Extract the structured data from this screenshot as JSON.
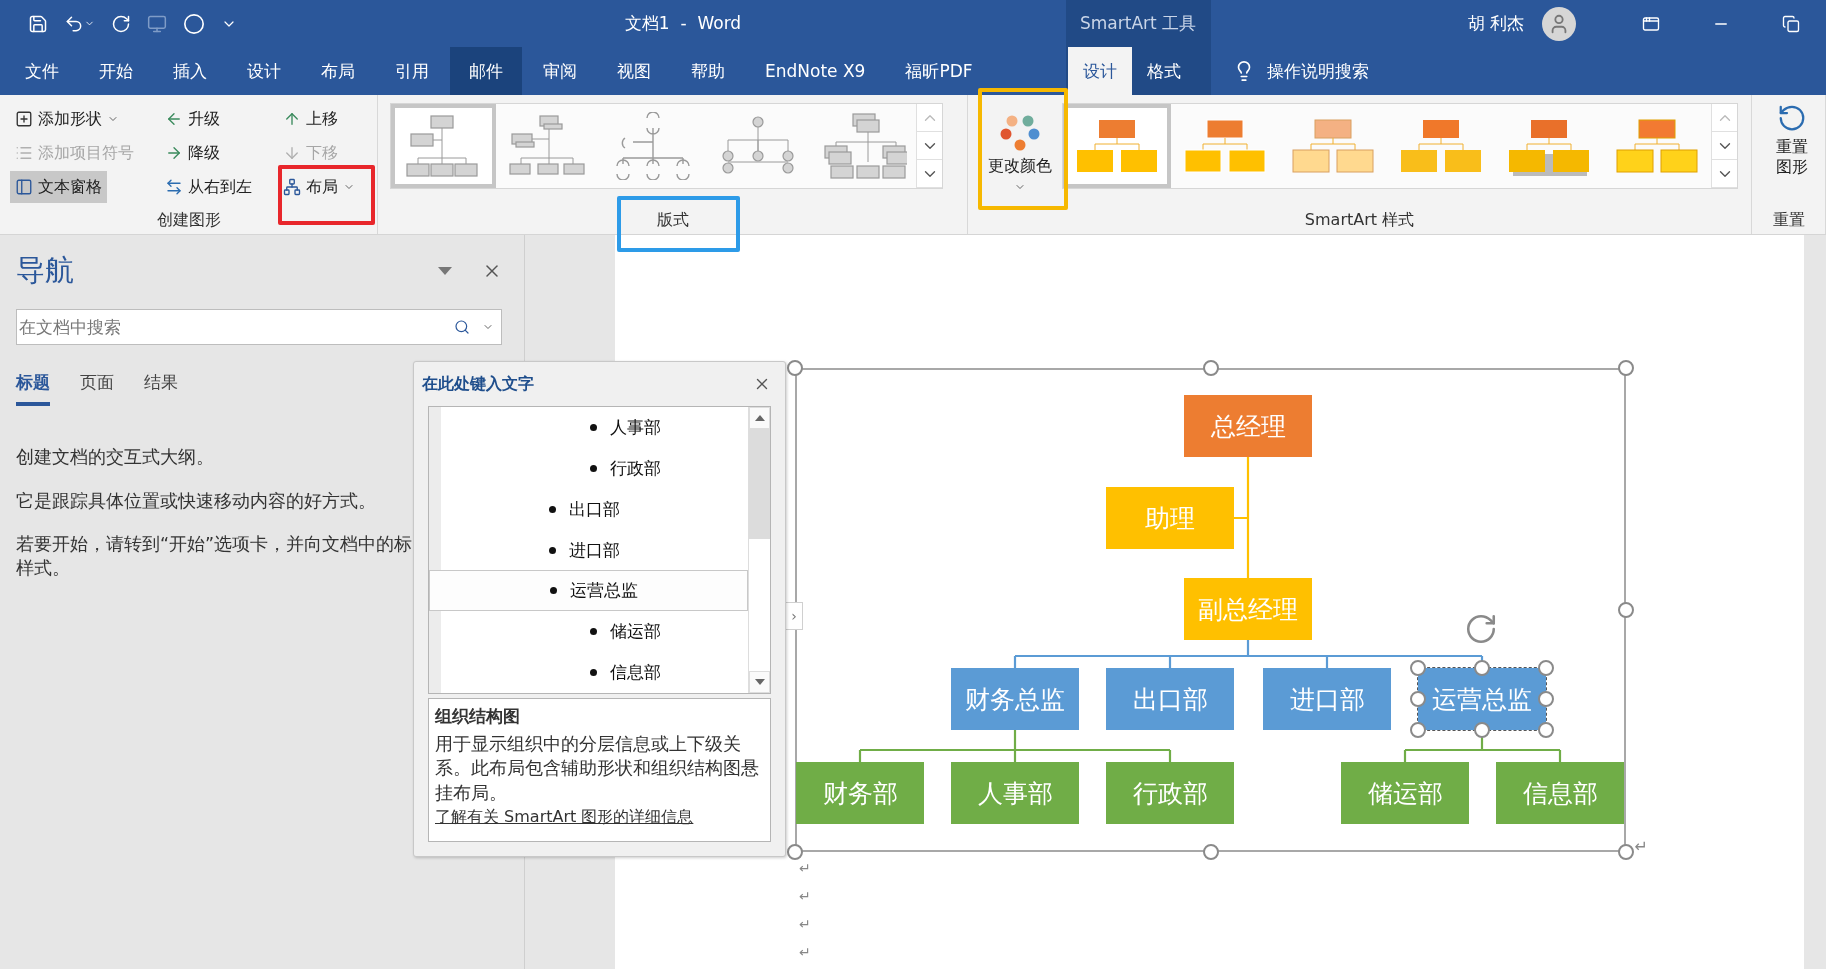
{
  "title_bar": {
    "title": "文档1  -  Word",
    "context_label": "SmartArt 工具",
    "user": "胡 利杰"
  },
  "ribbon_tabs": [
    {
      "label": "文件",
      "kind": "main",
      "selected": false,
      "hovered": false
    },
    {
      "label": "开始",
      "kind": "main",
      "selected": false,
      "hovered": false
    },
    {
      "label": "插入",
      "kind": "main",
      "selected": false,
      "hovered": false
    },
    {
      "label": "设计",
      "kind": "main",
      "selected": false,
      "hovered": false
    },
    {
      "label": "布局",
      "kind": "main",
      "selected": false,
      "hovered": false
    },
    {
      "label": "引用",
      "kind": "main",
      "selected": false,
      "hovered": false
    },
    {
      "label": "邮件",
      "kind": "main",
      "selected": false,
      "hovered": true
    },
    {
      "label": "审阅",
      "kind": "main",
      "selected": false,
      "hovered": false
    },
    {
      "label": "视图",
      "kind": "main",
      "selected": false,
      "hovered": false
    },
    {
      "label": "帮助",
      "kind": "main",
      "selected": false,
      "hovered": false
    },
    {
      "label": "EndNote X9",
      "kind": "main",
      "selected": false,
      "hovered": false
    },
    {
      "label": "福昕PDF",
      "kind": "main",
      "selected": false,
      "hovered": false
    },
    {
      "label": "设计",
      "kind": "contextual",
      "selected": true
    },
    {
      "label": "格式",
      "kind": "contextual",
      "selected": false
    }
  ],
  "tell_me": "操作说明搜索",
  "create_group": {
    "label": "创建图形",
    "commands": [
      {
        "label": "添加形状",
        "dropdown": true,
        "disabled": false,
        "pressed": false
      },
      {
        "label": "添加项目符号",
        "dropdown": false,
        "disabled": true,
        "pressed": false
      },
      {
        "label": "文本窗格",
        "dropdown": false,
        "disabled": false,
        "pressed": true
      },
      {
        "label": "升级",
        "dropdown": false,
        "disabled": false,
        "pressed": false
      },
      {
        "label": "降级",
        "dropdown": false,
        "disabled": false,
        "pressed": false
      },
      {
        "label": "从右到左",
        "dropdown": false,
        "disabled": false,
        "pressed": false
      },
      {
        "label": "上移",
        "dropdown": false,
        "disabled": false,
        "pressed": false
      },
      {
        "label": "下移",
        "dropdown": false,
        "disabled": true,
        "pressed": false
      },
      {
        "label": "布局",
        "dropdown": true,
        "disabled": false,
        "pressed": false
      }
    ]
  },
  "layouts_group": {
    "label": "版式",
    "items": [
      {
        "kind": "org",
        "selected": true
      },
      {
        "kind": "name-title",
        "selected": false
      },
      {
        "kind": "half-circle",
        "selected": false
      },
      {
        "kind": "circle",
        "selected": false
      },
      {
        "kind": "stacked",
        "selected": false
      }
    ]
  },
  "color_button": {
    "label": "更改颜色"
  },
  "styles_group": {
    "label": "SmartArt 样式",
    "items": [
      {
        "kind": "flat",
        "selected": true
      },
      {
        "kind": "simple",
        "selected": false
      },
      {
        "kind": "light",
        "selected": false
      },
      {
        "kind": "gradient",
        "selected": false
      },
      {
        "kind": "shadow",
        "selected": false
      },
      {
        "kind": "bevel",
        "selected": false
      }
    ]
  },
  "reset_group": {
    "label": "重置",
    "button": "重置图形"
  },
  "highlights": [
    {
      "color": "#e8262b"
    },
    {
      "color": "#2d9be8"
    },
    {
      "color": "#f6b800"
    }
  ],
  "navigation": {
    "title": "导航",
    "search_placeholder": "在文档中搜索",
    "tabs": [
      {
        "label": "标题",
        "selected": true
      },
      {
        "label": "页面",
        "selected": false
      },
      {
        "label": "结果",
        "selected": false
      }
    ],
    "paragraphs": [
      {
        "lines": [
          "创建文档的交互式大纲。"
        ]
      },
      {
        "lines": [
          "它是跟踪具体位置或快速移动内容的好方式。"
        ]
      },
      {
        "lines": [
          "若要开始，请转到“开始”选项卡，并向文档中的标",
          "样式。"
        ]
      }
    ]
  },
  "text_pane": {
    "title": "在此处键入文字",
    "items": [
      {
        "children": [
          {
            "text": "人事部",
            "selected": false
          },
          {
            "text": "行政部",
            "selected": false
          }
        ]
      },
      {
        "text": "出口部",
        "selected": false
      },
      {
        "text": "进口部",
        "selected": false
      },
      {
        "text": "运营总监",
        "selected": true,
        "children": [
          {
            "text": "储运部",
            "selected": false
          },
          {
            "text": "信息部",
            "selected": false
          }
        ]
      }
    ],
    "info": {
      "title": "组织结构图",
      "description": "用于显示组织中的分层信息或上下级关系。此布局包含辅助形状和组织结构图悬挂布局。",
      "link": "了解有关 SmartArt 图形的详细信息"
    }
  },
  "text_pane_toggle": "›",
  "org_chart": {
    "root": {
      "text": "总经理",
      "color": "#ed7d31",
      "kind": "main",
      "selected": false,
      "children": [
        {
          "text": "助理",
          "color": "#ffc000",
          "kind": "assistant",
          "selected": false
        },
        {
          "text": "副总经理",
          "color": "#ffc000",
          "kind": "main",
          "selected": false,
          "children": [
            {
              "text": "财务总监",
              "color": "#5b9bd5",
              "kind": "main",
              "selected": false,
              "children": [
                {
                  "text": "财务部",
                  "color": "#70ad47",
                  "kind": "main",
                  "selected": false
                },
                {
                  "text": "人事部",
                  "color": "#70ad47",
                  "kind": "main",
                  "selected": false
                },
                {
                  "text": "行政部",
                  "color": "#70ad47",
                  "kind": "main",
                  "selected": false
                }
              ]
            },
            {
              "text": "出口部",
              "color": "#5b9bd5",
              "kind": "main",
              "selected": false
            },
            {
              "text": "进口部",
              "color": "#5b9bd5",
              "kind": "main",
              "selected": false
            },
            {
              "text": "运营总监",
              "color": "#5b9bd5",
              "kind": "main",
              "selected": true,
              "children": [
                {
                  "text": "储运部",
                  "color": "#70ad47",
                  "kind": "main",
                  "selected": false
                },
                {
                  "text": "信息部",
                  "color": "#70ad47",
                  "kind": "main",
                  "selected": false
                }
              ]
            }
          ]
        }
      ]
    },
    "anchor_mark": "↵"
  },
  "paragraph_marks": [
    "↵",
    "↵",
    "↵",
    "↵"
  ]
}
